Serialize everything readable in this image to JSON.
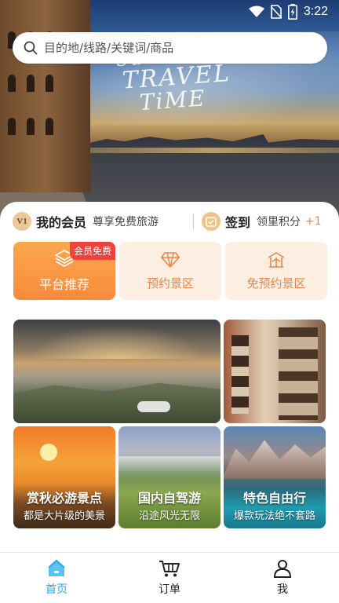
{
  "status_bar": {
    "time": "3:22"
  },
  "search": {
    "placeholder": "目的地/线路/关键词/商品"
  },
  "hero": {
    "line1": "Summer",
    "line2": "TRAVEL",
    "line3": "TiME"
  },
  "member": {
    "badge": "V1",
    "title": "我的会员",
    "subtitle": "尊享免费旅游"
  },
  "signin": {
    "title": "签到",
    "subtitle": "领里积分",
    "points": "+1"
  },
  "tiles": [
    {
      "label": "平台推荐",
      "tag": "会员免费",
      "icon": "layers-icon"
    },
    {
      "label": "预约景区",
      "icon": "diamond-icon"
    },
    {
      "label": "免预约景区",
      "icon": "temple-icon"
    }
  ],
  "gallery": [
    {
      "title": "",
      "subtitle": ""
    },
    {
      "title": "",
      "subtitle": ""
    },
    {
      "title": "赏秋必游景点",
      "subtitle": "都是大片级的美景"
    },
    {
      "title": "国内自驾游",
      "subtitle": "沿途风光无限"
    },
    {
      "title": "特色自由行",
      "subtitle": "爆款玩法绝不套路"
    }
  ],
  "nav": [
    {
      "label": "首页",
      "icon": "home-icon",
      "active": true
    },
    {
      "label": "订单",
      "icon": "cart-icon"
    },
    {
      "label": "我",
      "icon": "person-icon"
    }
  ],
  "colors": {
    "accent": "#F88A3C",
    "active_nav": "#2AA7E6",
    "tag_red": "#F0413A"
  }
}
